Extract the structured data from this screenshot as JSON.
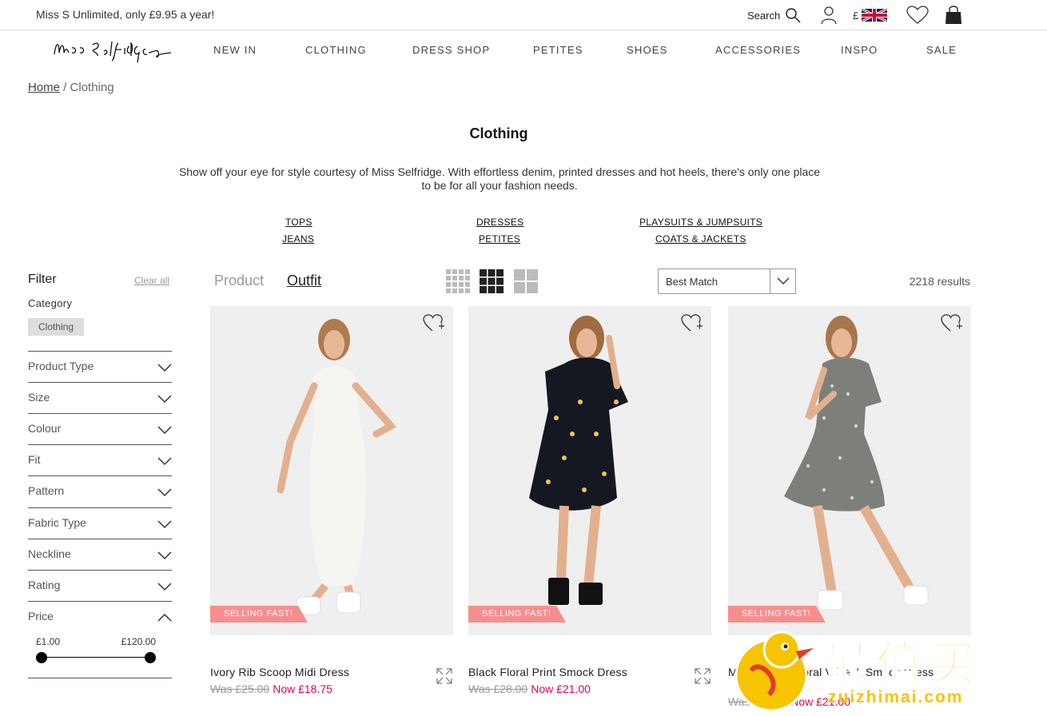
{
  "topbar": {
    "promo": "Miss S Unlimited, only £9.95 a year!",
    "search_label": "Search",
    "currency": "£"
  },
  "brand": {
    "logo_text": "Miss Selfridge"
  },
  "nav": {
    "items": [
      "NEW IN",
      "CLOTHING",
      "DRESS SHOP",
      "PETITES",
      "SHOES",
      "ACCESSORIES",
      "INSPO",
      "SALE"
    ]
  },
  "breadcrumb": {
    "home": "Home",
    "separator": " / ",
    "current": "Clothing"
  },
  "page": {
    "title": "Clothing",
    "description": "Show off your eye for style courtesy of Miss Selfridge. With effortless denim, printed dresses and hot heels, there's only one place to be for all your fashion needs."
  },
  "categories": [
    "TOPS",
    "JEANS",
    "DRESSES",
    "PETITES",
    "PLAYSUITS & JUMPSUITS",
    "COATS & JACKETS"
  ],
  "filter": {
    "title": "Filter",
    "clear_all": "Clear all",
    "category_label": "Category",
    "active_chip": "Clothing",
    "facets": [
      "Product Type",
      "Size",
      "Colour",
      "Fit",
      "Pattern",
      "Fabric Type",
      "Neckline",
      "Rating",
      "Price"
    ],
    "price_min": "£1.00",
    "price_max": "£120.00"
  },
  "toolbar": {
    "view_product": "Product",
    "view_outfit": "Outfit",
    "sort_value": "Best Match",
    "results": "2218 results"
  },
  "products": [
    {
      "name": "Ivory Rib Scoop Midi Dress",
      "was": "Was £25.00",
      "now": "Now £18.75",
      "badge": "SELLING FAST!"
    },
    {
      "name": "Black Floral Print Smock Dress",
      "was": "Was £28.00",
      "now": "Now £21.00",
      "badge": "SELLING FAST!"
    },
    {
      "name": "Multi Colour Floral V Neck Smock Dress",
      "was": "Was £28.00",
      "now": "Now £21.00",
      "badge": "SELLING FAST!"
    }
  ],
  "watermark": {
    "text": "最值买",
    "url": "zuizhimai.com"
  },
  "colors": {
    "sale_pink": "#e5005b",
    "badge_pink": "#f78e8e",
    "watermark": "#f7c400"
  }
}
